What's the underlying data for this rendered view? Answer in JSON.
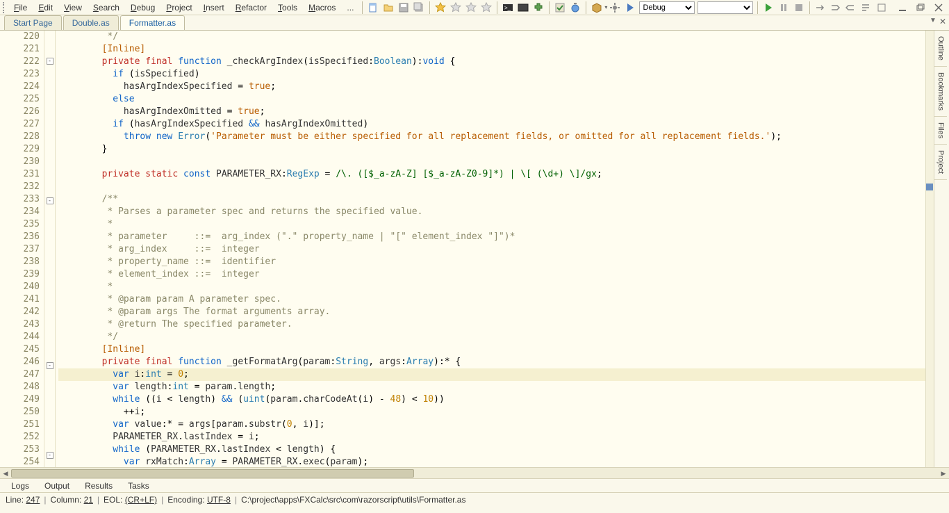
{
  "menu": {
    "items": [
      "File",
      "Edit",
      "View",
      "Search",
      "Debug",
      "Project",
      "Insert",
      "Refactor",
      "Tools",
      "Macros",
      "..."
    ],
    "combo_debug": "Debug",
    "combo_empty": ""
  },
  "tabs": {
    "items": [
      {
        "label": "Start Page",
        "active": false
      },
      {
        "label": "Double.as",
        "active": false
      },
      {
        "label": "Formatter.as",
        "active": true
      }
    ]
  },
  "side_tabs": [
    "Outline",
    "Bookmarks",
    "Files",
    "Project"
  ],
  "bottom_tabs": [
    "Logs",
    "Output",
    "Results",
    "Tasks"
  ],
  "status": {
    "line_label": "Line:",
    "line": "247",
    "col_label": "Column:",
    "col": "21",
    "eol_label": "EOL:",
    "eol": "(CR+LF)",
    "enc_label": "Encoding:",
    "enc": "UTF-8",
    "path": "C:\\project\\apps\\FXCalc\\src\\com\\razorscript\\utils\\Formatter.as"
  },
  "editor": {
    "first_line": 220,
    "current_line": 247,
    "fold_lines": [
      222,
      233,
      246,
      253
    ],
    "lines": [
      {
        "n": 220,
        "html": "         <span class='com'>*/</span>"
      },
      {
        "n": 221,
        "html": "        <span class='meta'>[Inline]</span>"
      },
      {
        "n": 222,
        "html": "        <span class='red'>private</span> <span class='red'>final</span> <span class='kw'>function</span> <span class='ident'>_checkArgIndex</span>(<span class='ident'>isSpecified</span>:<span class='type'>Boolean</span>):<span class='kw'>void</span> {"
      },
      {
        "n": 223,
        "html": "          <span class='kw'>if</span> (<span class='ident'>isSpecified</span>)"
      },
      {
        "n": 224,
        "html": "            <span class='ident'>hasArgIndexSpecified</span> = <span class='bool'>true</span>;"
      },
      {
        "n": 225,
        "html": "          <span class='kw'>else</span>"
      },
      {
        "n": 226,
        "html": "            <span class='ident'>hasArgIndexOmitted</span> = <span class='bool'>true</span>;"
      },
      {
        "n": 227,
        "html": "          <span class='kw'>if</span> (<span class='ident'>hasArgIndexSpecified</span> <span class='kw'>&amp;&amp;</span> <span class='ident'>hasArgIndexOmitted</span>)"
      },
      {
        "n": 228,
        "html": "            <span class='kw'>throw</span> <span class='kw'>new</span> <span class='type'>Error</span>(<span class='str'>'Parameter must be either specified for all replacement fields, or omitted for all replacement fields.'</span>);"
      },
      {
        "n": 229,
        "html": "        }"
      },
      {
        "n": 230,
        "html": ""
      },
      {
        "n": 231,
        "html": "        <span class='red'>private</span> <span class='red'>static</span> <span class='kw'>const</span> <span class='ident'>PARAMETER_RX</span>:<span class='type'>RegExp</span> = <span class='regex'>/\\. ([$_a-zA-Z] [$_a-zA-Z0-9]*) | \\[ (\\d+) \\]/gx</span>;"
      },
      {
        "n": 232,
        "html": ""
      },
      {
        "n": 233,
        "html": "        <span class='com'>/**</span>"
      },
      {
        "n": 234,
        "html": "         <span class='com'>* Parses a parameter spec and returns the specified value.</span>"
      },
      {
        "n": 235,
        "html": "         <span class='com'>*</span>"
      },
      {
        "n": 236,
        "html": "         <span class='com'>* parameter     ::=  arg_index (\".\" property_name | \"[\" element_index \"]\")*</span>"
      },
      {
        "n": 237,
        "html": "         <span class='com'>* arg_index     ::=  integer</span>"
      },
      {
        "n": 238,
        "html": "         <span class='com'>* property_name ::=  identifier</span>"
      },
      {
        "n": 239,
        "html": "         <span class='com'>* element_index ::=  integer</span>"
      },
      {
        "n": 240,
        "html": "         <span class='com'>*</span>"
      },
      {
        "n": 241,
        "html": "         <span class='com'>* @param param A parameter spec.</span>"
      },
      {
        "n": 242,
        "html": "         <span class='com'>* @param args The format arguments array.</span>"
      },
      {
        "n": 243,
        "html": "         <span class='com'>* @return The specified parameter.</span>"
      },
      {
        "n": 244,
        "html": "         <span class='com'>*/</span>"
      },
      {
        "n": 245,
        "html": "        <span class='meta'>[Inline]</span>"
      },
      {
        "n": 246,
        "html": "        <span class='red'>private</span> <span class='red'>final</span> <span class='kw'>function</span> <span class='ident'>_getFormatArg</span>(<span class='ident'>param</span>:<span class='type'>String</span>, <span class='ident'>args</span>:<span class='type'>Array</span>):* {"
      },
      {
        "n": 247,
        "html": "          <span class='kw'>var</span> <span class='ident'>i</span>:<span class='type'>int</span> = <span class='num'>0</span>;"
      },
      {
        "n": 248,
        "html": "          <span class='kw'>var</span> <span class='ident'>length</span>:<span class='type'>int</span> = <span class='ident'>param</span>.<span class='ident'>length</span>;"
      },
      {
        "n": 249,
        "html": "          <span class='kw'>while</span> ((<span class='ident'>i</span> &lt; <span class='ident'>length</span>) <span class='kw'>&amp;&amp;</span> (<span class='type'>uint</span>(<span class='ident'>param</span>.<span class='ident'>charCodeAt</span>(<span class='ident'>i</span>) - <span class='num'>48</span>) &lt; <span class='num'>10</span>))"
      },
      {
        "n": 250,
        "html": "            ++<span class='ident'>i</span>;"
      },
      {
        "n": 251,
        "html": "          <span class='kw'>var</span> <span class='ident'>value</span>:* = <span class='ident'>args</span>[<span class='ident'>param</span>.<span class='ident'>substr</span>(<span class='num'>0</span>, <span class='ident'>i</span>)];"
      },
      {
        "n": 252,
        "html": "          <span class='ident'>PARAMETER_RX</span>.<span class='ident'>lastIndex</span> = <span class='ident'>i</span>;"
      },
      {
        "n": 253,
        "html": "          <span class='kw'>while</span> (<span class='ident'>PARAMETER_RX</span>.<span class='ident'>lastIndex</span> &lt; <span class='ident'>length</span>) {"
      },
      {
        "n": 254,
        "html": "            <span class='kw'>var</span> <span class='ident'>rxMatch</span>:<span class='type'>Array</span> = <span class='ident'>PARAMETER_RX</span>.<span class='ident'>exec</span>(<span class='ident'>param</span>);"
      }
    ]
  }
}
